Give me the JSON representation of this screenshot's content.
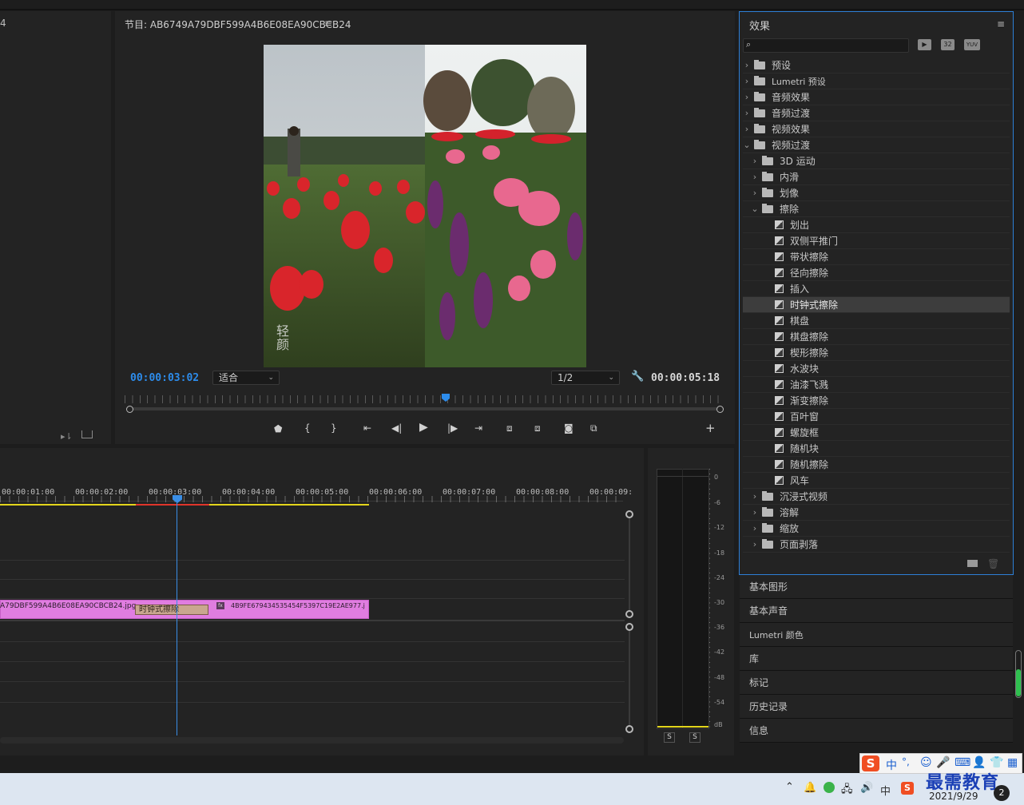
{
  "source_panel": {
    "partial_label": "4"
  },
  "program": {
    "title": "节目: AB6749A79DBF599A4B6E08EA90CBCB24",
    "timecode_current": "00:00:03:02",
    "fit_value": "适合",
    "resolution_value": "1/2",
    "timecode_duration": "00:00:05:18",
    "watermark": "轻颜"
  },
  "effects": {
    "title": "效果",
    "search_placeholder": "",
    "badge_icons": [
      "accelerated-icon",
      "32bit-icon",
      "yuv-icon"
    ],
    "badges": [
      "▶",
      "32",
      "YUV"
    ],
    "tree": [
      {
        "label": "预设",
        "level": 0,
        "expanded": false,
        "kind": "preset"
      },
      {
        "label": "Lumetri 预设",
        "level": 0,
        "expanded": false,
        "kind": "preset"
      },
      {
        "label": "音频效果",
        "level": 0,
        "expanded": false,
        "kind": "folder"
      },
      {
        "label": "音频过渡",
        "level": 0,
        "expanded": false,
        "kind": "folder"
      },
      {
        "label": "视频效果",
        "level": 0,
        "expanded": false,
        "kind": "folder"
      },
      {
        "label": "视频过渡",
        "level": 0,
        "expanded": true,
        "kind": "folder"
      },
      {
        "label": "3D 运动",
        "level": 1,
        "expanded": false,
        "kind": "folder"
      },
      {
        "label": "内滑",
        "level": 1,
        "expanded": false,
        "kind": "folder"
      },
      {
        "label": "划像",
        "level": 1,
        "expanded": false,
        "kind": "folder"
      },
      {
        "label": "擦除",
        "level": 1,
        "expanded": true,
        "kind": "folder"
      },
      {
        "label": "划出",
        "level": 2,
        "kind": "transition"
      },
      {
        "label": "双侧平推门",
        "level": 2,
        "kind": "transition"
      },
      {
        "label": "带状擦除",
        "level": 2,
        "kind": "transition"
      },
      {
        "label": "径向擦除",
        "level": 2,
        "kind": "transition"
      },
      {
        "label": "插入",
        "level": 2,
        "kind": "transition"
      },
      {
        "label": "时钟式擦除",
        "level": 2,
        "kind": "transition",
        "selected": true
      },
      {
        "label": "棋盘",
        "level": 2,
        "kind": "transition"
      },
      {
        "label": "棋盘擦除",
        "level": 2,
        "kind": "transition"
      },
      {
        "label": "楔形擦除",
        "level": 2,
        "kind": "transition"
      },
      {
        "label": "水波块",
        "level": 2,
        "kind": "transition"
      },
      {
        "label": "油漆飞溅",
        "level": 2,
        "kind": "transition"
      },
      {
        "label": "渐变擦除",
        "level": 2,
        "kind": "transition"
      },
      {
        "label": "百叶窗",
        "level": 2,
        "kind": "transition"
      },
      {
        "label": "螺旋框",
        "level": 2,
        "kind": "transition"
      },
      {
        "label": "随机块",
        "level": 2,
        "kind": "transition"
      },
      {
        "label": "随机擦除",
        "level": 2,
        "kind": "transition"
      },
      {
        "label": "风车",
        "level": 2,
        "kind": "transition"
      },
      {
        "label": "沉浸式视频",
        "level": 1,
        "expanded": false,
        "kind": "folder"
      },
      {
        "label": "溶解",
        "level": 1,
        "expanded": false,
        "kind": "folder"
      },
      {
        "label": "缩放",
        "level": 1,
        "expanded": false,
        "kind": "folder"
      },
      {
        "label": "页面剥落",
        "level": 1,
        "expanded": false,
        "kind": "folder"
      }
    ]
  },
  "side_panels": [
    "基本图形",
    "基本声音",
    "Lumetri 颜色",
    "库",
    "标记",
    "历史记录",
    "信息"
  ],
  "timeline": {
    "ruler": [
      "00:00:01:00",
      "00:00:02:00",
      "00:00:03:00",
      "00:00:04:00",
      "00:00:05:00",
      "00:00:06:00",
      "00:00:07:00",
      "00:00:08:00",
      "00:00:09:"
    ],
    "clip1": "A79DBF599A4B6E08EA90CBCB24.jpg",
    "transition": "时钟式擦除",
    "clip2": "4B9FE679434535454F5397C19E2AE977.j",
    "clip_color": "#e07de0"
  },
  "meter": {
    "ticks": [
      "0",
      "-6",
      "-12",
      "-18",
      "-24",
      "-30",
      "-36",
      "-42",
      "-48",
      "-54",
      "dB"
    ],
    "solo": [
      "S",
      "S"
    ]
  },
  "taskbar": {
    "ime_cn": "中",
    "ime_punct": "°,",
    "tray_cn": "中",
    "date": "2021/9/29",
    "brand": "最需教育",
    "badge": "2"
  },
  "colors": {
    "accent": "#2d8ceb",
    "playhead": "#3a8ee6",
    "panel_border": "#2d7fd6"
  }
}
